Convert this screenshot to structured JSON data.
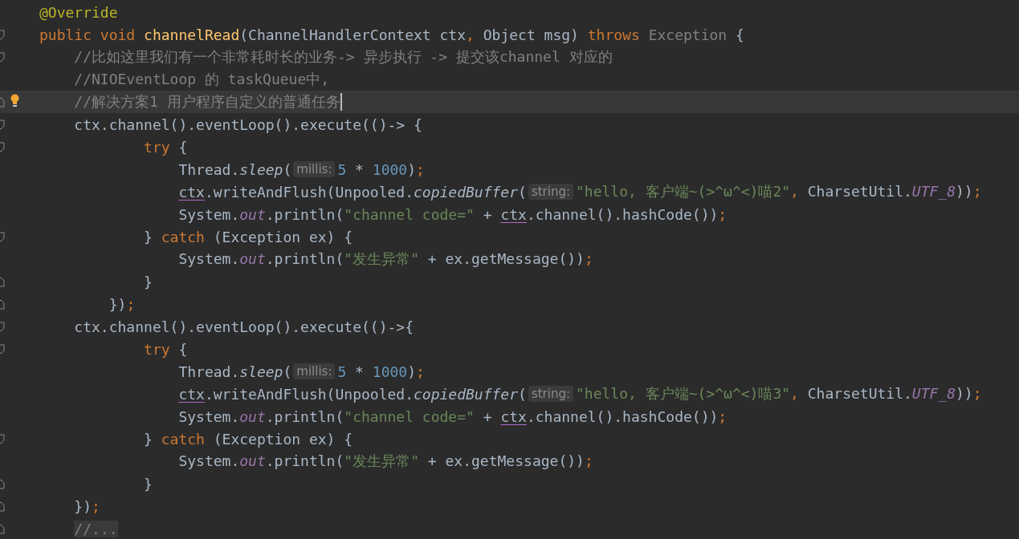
{
  "editor": {
    "lines": [
      {
        "current": false,
        "fold_start": false,
        "fold_end": false,
        "tokens": [
          {
            "kind": "annotation",
            "text": "@Override"
          }
        ]
      },
      {
        "current": false,
        "fold_start": true,
        "fold_end": false,
        "tokens": [
          {
            "kind": "keyword",
            "text": "public void "
          },
          {
            "kind": "declaration",
            "text": "channelRead"
          },
          {
            "kind": "plain",
            "text": "(ChannelHandlerContext ctx"
          },
          {
            "kind": "keyword",
            "text": ", "
          },
          {
            "kind": "plain",
            "text": "Object msg) "
          },
          {
            "kind": "keyword",
            "text": "throws "
          },
          {
            "kind": "unused",
            "text": "Exception"
          },
          {
            "kind": "plain",
            "text": " {"
          }
        ]
      },
      {
        "current": false,
        "fold_start": true,
        "fold_end": false,
        "tokens": [
          {
            "kind": "comment",
            "text": "    //比如这里我们有一个非常耗时长的业务-> 异步执行 -> 提交该channel 对应的"
          }
        ]
      },
      {
        "current": false,
        "fold_start": false,
        "fold_end": false,
        "tokens": [
          {
            "kind": "comment",
            "text": "    //NIOEventLoop 的 taskQueue中,"
          }
        ]
      },
      {
        "current": true,
        "caret": true,
        "bulb": true,
        "fold_start": false,
        "fold_end": true,
        "tokens": [
          {
            "kind": "comment",
            "text": "    //解决方案1 用户程序自定义的普通任务"
          }
        ]
      },
      {
        "current": false,
        "fold_start": true,
        "fold_end": false,
        "tokens": [
          {
            "kind": "plain",
            "text": "    ctx.channel().eventLoop().execute(()-> {"
          }
        ]
      },
      {
        "current": false,
        "fold_start": true,
        "fold_end": false,
        "tokens": [
          {
            "kind": "keyword",
            "text": "            try"
          },
          {
            "kind": "plain",
            "text": " {"
          }
        ]
      },
      {
        "current": false,
        "fold_start": false,
        "fold_end": false,
        "tokens": [
          {
            "kind": "plain",
            "text": "                Thread."
          },
          {
            "kind": "static-method",
            "text": "sleep"
          },
          {
            "kind": "plain",
            "text": "("
          },
          {
            "kind": "hint",
            "text": "millis:"
          },
          {
            "kind": "number",
            "text": "5"
          },
          {
            "kind": "plain",
            "text": " * "
          },
          {
            "kind": "number",
            "text": "1000"
          },
          {
            "kind": "plain",
            "text": ")"
          },
          {
            "kind": "keyword",
            "text": ";"
          }
        ]
      },
      {
        "current": false,
        "fold_start": false,
        "fold_end": false,
        "tokens": [
          {
            "kind": "underlined",
            "text": "                ctx"
          },
          {
            "kind": "plain",
            "text": ".writeAndFlush(Unpooled."
          },
          {
            "kind": "static-method",
            "text": "copiedBuffer"
          },
          {
            "kind": "plain",
            "text": "("
          },
          {
            "kind": "hint",
            "text": "string:"
          },
          {
            "kind": "string",
            "text": "\"hello, 客户端~(>^ω^<)喵2\""
          },
          {
            "kind": "keyword",
            "text": ", "
          },
          {
            "kind": "plain",
            "text": "CharsetUtil."
          },
          {
            "kind": "static-field",
            "text": "UTF_8"
          },
          {
            "kind": "plain",
            "text": "))"
          },
          {
            "kind": "keyword",
            "text": ";"
          }
        ]
      },
      {
        "current": false,
        "fold_start": false,
        "fold_end": false,
        "tokens": [
          {
            "kind": "plain",
            "text": "                System."
          },
          {
            "kind": "static-field",
            "text": "out"
          },
          {
            "kind": "plain",
            "text": ".println("
          },
          {
            "kind": "string",
            "text": "\"channel code=\""
          },
          {
            "kind": "plain",
            "text": " + "
          },
          {
            "kind": "underlined",
            "text": "ctx"
          },
          {
            "kind": "plain",
            "text": ".channel().hashCode())"
          },
          {
            "kind": "keyword",
            "text": ";"
          }
        ]
      },
      {
        "current": false,
        "fold_start": true,
        "fold_end": false,
        "tokens": [
          {
            "kind": "plain",
            "text": "            } "
          },
          {
            "kind": "keyword",
            "text": "catch"
          },
          {
            "kind": "plain",
            "text": " (Exception ex) {"
          }
        ]
      },
      {
        "current": false,
        "fold_start": false,
        "fold_end": false,
        "tokens": [
          {
            "kind": "plain",
            "text": "                System."
          },
          {
            "kind": "static-field",
            "text": "out"
          },
          {
            "kind": "plain",
            "text": ".println("
          },
          {
            "kind": "string",
            "text": "\"发生异常\""
          },
          {
            "kind": "plain",
            "text": " + ex.getMessage())"
          },
          {
            "kind": "keyword",
            "text": ";"
          }
        ]
      },
      {
        "current": false,
        "fold_start": false,
        "fold_end": true,
        "tokens": [
          {
            "kind": "plain",
            "text": "            }"
          }
        ]
      },
      {
        "current": false,
        "fold_start": false,
        "fold_end": true,
        "tokens": [
          {
            "kind": "plain",
            "text": "        })"
          },
          {
            "kind": "keyword",
            "text": ";"
          }
        ]
      },
      {
        "current": false,
        "fold_start": true,
        "fold_end": false,
        "tokens": [
          {
            "kind": "plain",
            "text": "    ctx.channel().eventLoop().execute(()->{"
          }
        ]
      },
      {
        "current": false,
        "fold_start": true,
        "fold_end": false,
        "tokens": [
          {
            "kind": "keyword",
            "text": "            try"
          },
          {
            "kind": "plain",
            "text": " {"
          }
        ]
      },
      {
        "current": false,
        "fold_start": false,
        "fold_end": false,
        "tokens": [
          {
            "kind": "plain",
            "text": "                Thread."
          },
          {
            "kind": "static-method",
            "text": "sleep"
          },
          {
            "kind": "plain",
            "text": "("
          },
          {
            "kind": "hint",
            "text": "millis:"
          },
          {
            "kind": "number",
            "text": "5"
          },
          {
            "kind": "plain",
            "text": " * "
          },
          {
            "kind": "number",
            "text": "1000"
          },
          {
            "kind": "plain",
            "text": ")"
          },
          {
            "kind": "keyword",
            "text": ";"
          }
        ]
      },
      {
        "current": false,
        "fold_start": false,
        "fold_end": false,
        "tokens": [
          {
            "kind": "underlined",
            "text": "                ctx"
          },
          {
            "kind": "plain",
            "text": ".writeAndFlush(Unpooled."
          },
          {
            "kind": "static-method",
            "text": "copiedBuffer"
          },
          {
            "kind": "plain",
            "text": "("
          },
          {
            "kind": "hint",
            "text": "string:"
          },
          {
            "kind": "string",
            "text": "\"hello, 客户端~(>^ω^<)喵3\""
          },
          {
            "kind": "keyword",
            "text": ", "
          },
          {
            "kind": "plain",
            "text": "CharsetUtil."
          },
          {
            "kind": "static-field",
            "text": "UTF_8"
          },
          {
            "kind": "plain",
            "text": "))"
          },
          {
            "kind": "keyword",
            "text": ";"
          }
        ]
      },
      {
        "current": false,
        "fold_start": false,
        "fold_end": false,
        "tokens": [
          {
            "kind": "plain",
            "text": "                System."
          },
          {
            "kind": "static-field",
            "text": "out"
          },
          {
            "kind": "plain",
            "text": ".println("
          },
          {
            "kind": "string",
            "text": "\"channel code=\""
          },
          {
            "kind": "plain",
            "text": " + "
          },
          {
            "kind": "underlined",
            "text": "ctx"
          },
          {
            "kind": "plain",
            "text": ".channel().hashCode())"
          },
          {
            "kind": "keyword",
            "text": ";"
          }
        ]
      },
      {
        "current": false,
        "fold_start": true,
        "fold_end": false,
        "tokens": [
          {
            "kind": "plain",
            "text": "            } "
          },
          {
            "kind": "keyword",
            "text": "catch"
          },
          {
            "kind": "plain",
            "text": " (Exception ex) {"
          }
        ]
      },
      {
        "current": false,
        "fold_start": false,
        "fold_end": false,
        "tokens": [
          {
            "kind": "plain",
            "text": "                System."
          },
          {
            "kind": "static-field",
            "text": "out"
          },
          {
            "kind": "plain",
            "text": ".println("
          },
          {
            "kind": "string",
            "text": "\"发生异常\""
          },
          {
            "kind": "plain",
            "text": " + ex.getMessage())"
          },
          {
            "kind": "keyword",
            "text": ";"
          }
        ]
      },
      {
        "current": false,
        "fold_start": false,
        "fold_end": true,
        "tokens": [
          {
            "kind": "plain",
            "text": "            }"
          }
        ]
      },
      {
        "current": false,
        "fold_start": false,
        "fold_end": true,
        "tokens": [
          {
            "kind": "plain",
            "text": "    })"
          },
          {
            "kind": "keyword",
            "text": ";"
          }
        ]
      },
      {
        "current": false,
        "fold_start": false,
        "fold_end": true,
        "tokens": [
          {
            "kind": "folded",
            "text": "    //..."
          }
        ]
      }
    ]
  }
}
